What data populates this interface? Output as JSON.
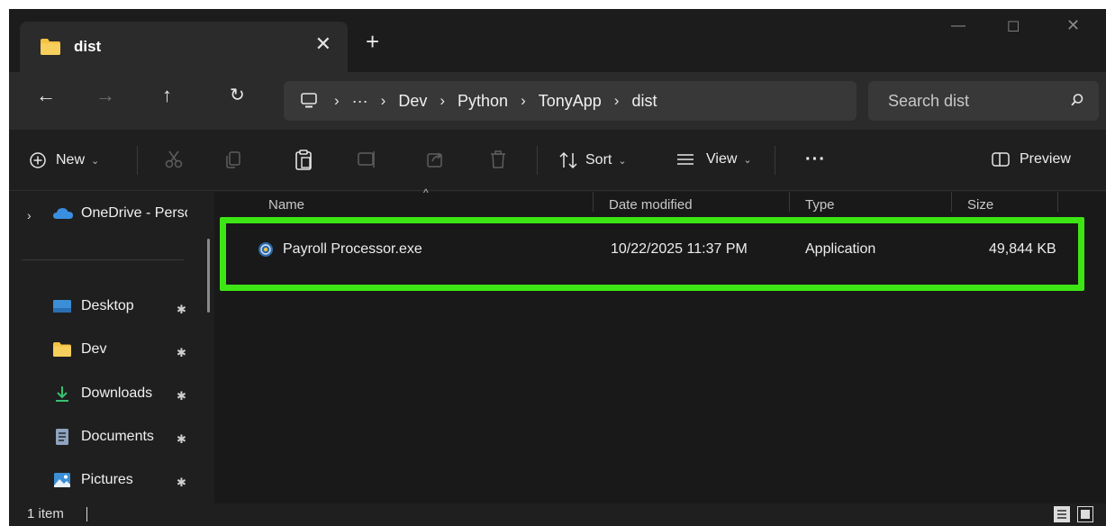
{
  "tab": {
    "title": "dist",
    "close": "✕",
    "new_tab": "+"
  },
  "window_controls": {
    "minimize": "—",
    "maximize": "☐",
    "close": "✕"
  },
  "nav": {
    "back": "←",
    "forward": "→",
    "up": "↑",
    "refresh": "↻"
  },
  "address": {
    "overflow": "···",
    "crumbs": [
      "Dev",
      "Python",
      "TonyApp",
      "dist"
    ],
    "separator": "›"
  },
  "search": {
    "placeholder": "Search dist"
  },
  "toolbar": {
    "new_label": "New",
    "sort_label": "Sort",
    "view_label": "View",
    "more_label": "···",
    "preview_label": "Preview",
    "chevron": "⌄"
  },
  "sidebar": {
    "expand": "›",
    "onedrive_label": "OneDrive - Personal",
    "items": [
      {
        "label": "Desktop",
        "icon": "desktop-icon"
      },
      {
        "label": "Dev",
        "icon": "folder-icon"
      },
      {
        "label": "Downloads",
        "icon": "download-icon"
      },
      {
        "label": "Documents",
        "icon": "documents-icon"
      },
      {
        "label": "Pictures",
        "icon": "pictures-icon"
      }
    ],
    "pin": "📌"
  },
  "columns": {
    "name": "Name",
    "date": "Date modified",
    "type": "Type",
    "size": "Size",
    "sort_arrow": "^"
  },
  "files": [
    {
      "name": "Payroll Processor.exe",
      "date": "10/22/2025 11:37 PM",
      "type": "Application",
      "size": "49,844 KB"
    }
  ],
  "status": {
    "item_count": "1 item"
  },
  "colors": {
    "highlight": "#3de515",
    "folder": "#f5c242",
    "onedrive": "#3a8fe0"
  }
}
